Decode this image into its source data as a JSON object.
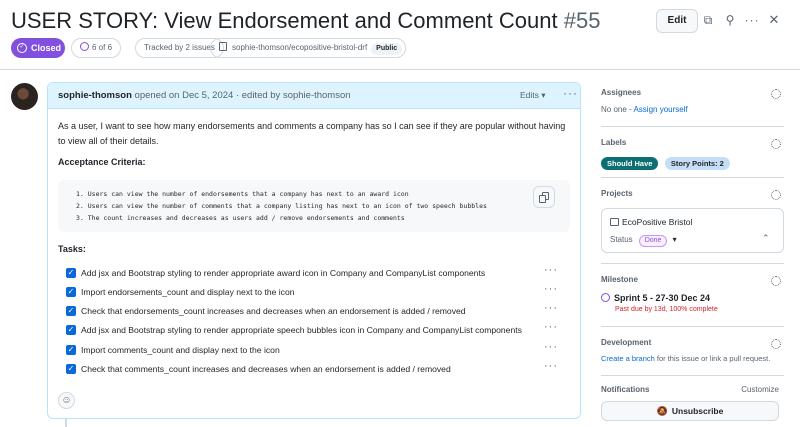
{
  "issue": {
    "title": "USER STORY: View Endorsement and Comment Count",
    "number": "#55",
    "state": "Closed",
    "subtasks": "6 of 6",
    "tracked_by": "Tracked by 2 issues",
    "repo": "sophie-thomson/ecopositive-bristol-drf",
    "visibility": "Public",
    "edit_label": "Edit"
  },
  "comment": {
    "author": "sophie-thomson",
    "opened": "opened on Dec 5, 2024 · edited by sophie-thomson",
    "edits_label": "Edits",
    "story": "As a user, I want to see how many endorsements and comments a company has so I can see if they are popular without having to view all of their details.",
    "acceptance_heading": "Acceptance Criteria:",
    "criteria": [
      "1. Users can view the number of endorsements that a company has next to an award icon",
      "2. Users can view the number of comments that a company listing has next to an icon of two speech bubbles",
      "3. The count increases and decreases as users add / remove endorsements and comments"
    ],
    "tasks_heading": "Tasks:",
    "tasks": [
      "Add jsx and Bootstrap styling to render appropriate award icon in Company and CompanyList components",
      "Import endorsements_count and display next to the icon",
      "Check that endorsements_count increases and decreases when an endorsement is added / removed",
      "Add jsx and Bootstrap styling to render appropriate speech bubbles icon in Company and CompanyList components",
      "Import comments_count and display next to the icon",
      "Check that comments_count increases and decreases when an endorsement is added / removed"
    ]
  },
  "sidebar": {
    "assignees": {
      "title": "Assignees",
      "none": "No one -",
      "assign": "Assign yourself"
    },
    "labels": {
      "title": "Labels",
      "items": [
        {
          "text": "Should Have",
          "bg": "#0e6f73",
          "fg": "#ffffff"
        },
        {
          "text": "Story Points: 2",
          "bg": "#c5def5",
          "fg": "#1f2328"
        }
      ]
    },
    "projects": {
      "title": "Projects",
      "name": "EcoPositive Bristol",
      "status_label": "Status",
      "status": "Done"
    },
    "milestone": {
      "title": "Milestone",
      "name": "Sprint 5 - 27-30 Dec 24",
      "due": "Past due by 13d, 100% complete"
    },
    "development": {
      "title": "Development",
      "link": "Create a branch",
      "rest": "for this issue or link a pull request."
    },
    "notifications": {
      "title": "Notifications",
      "customize": "Customize",
      "unsubscribe": "Unsubscribe"
    }
  },
  "colors": {
    "accent": "#0969da",
    "closed": "#8250df",
    "danger": "#d1242f"
  }
}
